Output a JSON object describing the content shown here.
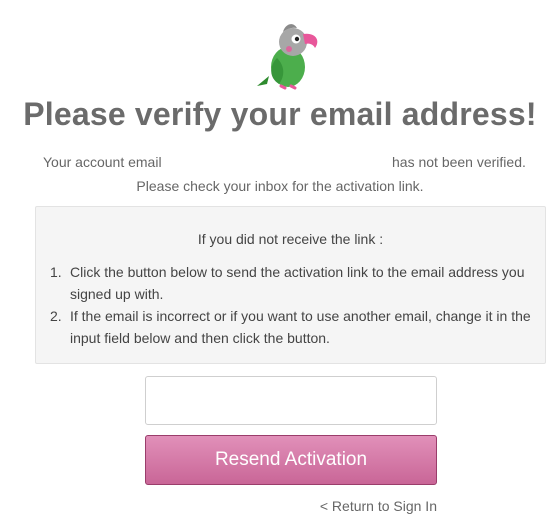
{
  "logo": {
    "icon": "parrot-logo",
    "colors": {
      "body": "#4cae4c",
      "head": "#9e9e9e",
      "beak": "#e8579a"
    }
  },
  "heading": "Please verify your email address!",
  "message": {
    "prefix": "Your account email",
    "suffix": "has not been verified.",
    "instruction": "Please check your inbox for the activation link."
  },
  "help_panel": {
    "heading": "If you did not receive the link :",
    "steps": [
      {
        "number": "1.",
        "text": "Click the button below to send the activation link to the email address you signed up with."
      },
      {
        "number": "2.",
        "text": "If the email is incorrect or if you want to use another email, change it in the input field below and then click the button."
      }
    ]
  },
  "email_input": {
    "value": "",
    "placeholder": ""
  },
  "resend_button": {
    "label": "Resend Activation",
    "color": "#d678a6"
  },
  "return_link": {
    "label": "< Return to Sign In"
  }
}
